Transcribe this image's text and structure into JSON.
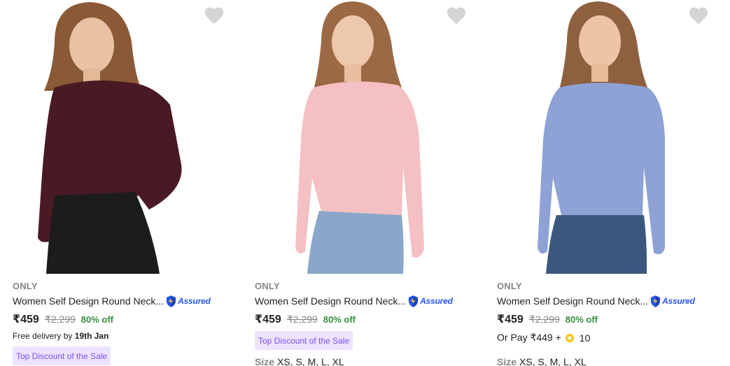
{
  "colors": {
    "wishlist_heart": "#d4d4d4",
    "brand_text": "#878787",
    "discount_green": "#388e3c",
    "tag_bg": "#ece3ff",
    "tag_text": "#7d4fe6",
    "assured_blue": "#2a55e5",
    "coin_gold": "#f5c518"
  },
  "products": [
    {
      "image_icon": "product-photo-maroon-sweater",
      "sweater_color": "#4a1a24",
      "bottom_color": "#1c1c1c",
      "brand": "ONLY",
      "title": "Women Self Design Round Neck...",
      "assured_label": "Assured",
      "price": "₹459",
      "mrp": "₹2,299",
      "discount": "80% off",
      "delivery_prefix": "Free delivery by",
      "delivery_date": "19th Jan",
      "tag": "Top Discount of the Sale"
    },
    {
      "image_icon": "product-photo-pink-sweater",
      "sweater_color": "#f4c0c3",
      "bottom_color": "#8aa6c8",
      "brand": "ONLY",
      "title": "Women Self Design Round Neck...",
      "assured_label": "Assured",
      "price": "₹459",
      "mrp": "₹2,299",
      "discount": "80% off",
      "tag": "Top Discount of the Sale",
      "size_label": "Size",
      "sizes": "XS, S, M, L, XL"
    },
    {
      "image_icon": "product-photo-blue-sweater",
      "sweater_color": "#8ea2d6",
      "bottom_color": "#3b577e",
      "brand": "ONLY",
      "title": "Women Self Design Round Neck...",
      "assured_label": "Assured",
      "price": "₹459",
      "mrp": "₹2,299",
      "discount": "80% off",
      "or_pay_prefix": "Or Pay ₹449 +",
      "coins": "10",
      "size_label": "Size",
      "sizes": "XS, S, M, L, XL"
    }
  ]
}
